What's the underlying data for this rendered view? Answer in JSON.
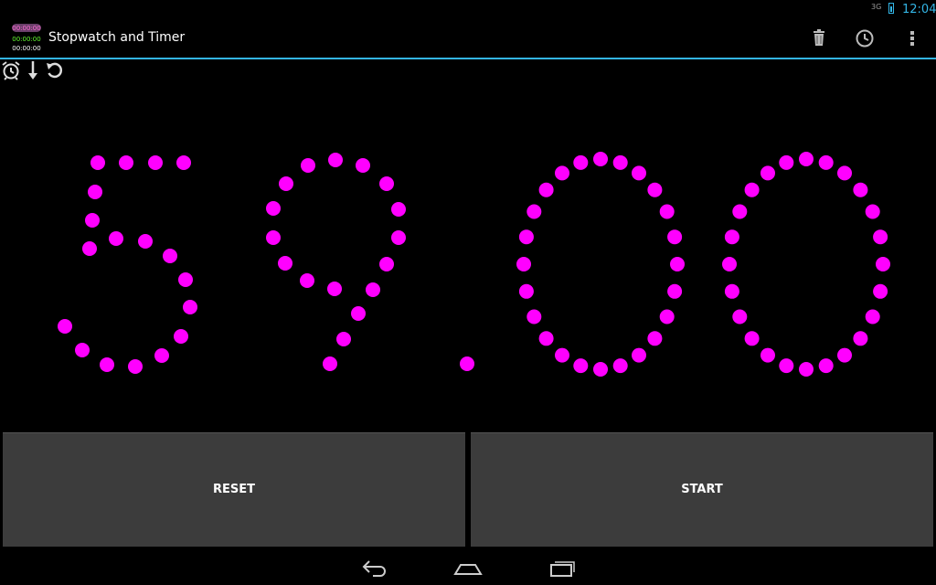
{
  "status_bar": {
    "network": "3G",
    "time": "12:04",
    "icons": [
      "signal-icon",
      "battery-icon"
    ]
  },
  "action_bar": {
    "app_icon_lines": [
      "00:00:00",
      "00:00:00",
      "00:00:00"
    ],
    "title": "Stopwatch and Timer",
    "actions": [
      "delete-icon",
      "history-icon",
      "overflow-menu-icon"
    ]
  },
  "tools": {
    "icons": [
      "alarm-icon",
      "arrow-down-icon",
      "reset-icon"
    ]
  },
  "display": {
    "time": "59.00",
    "dot_color": "#ff00ff"
  },
  "buttons": {
    "reset": "RESET",
    "start": "START"
  },
  "nav_bar": {
    "icons": [
      "back-icon",
      "home-icon",
      "recent-apps-icon"
    ]
  },
  "colors": {
    "accent": "#33b5e5",
    "button_bg": "#3c3c3c",
    "dot": "#ff00ff"
  }
}
